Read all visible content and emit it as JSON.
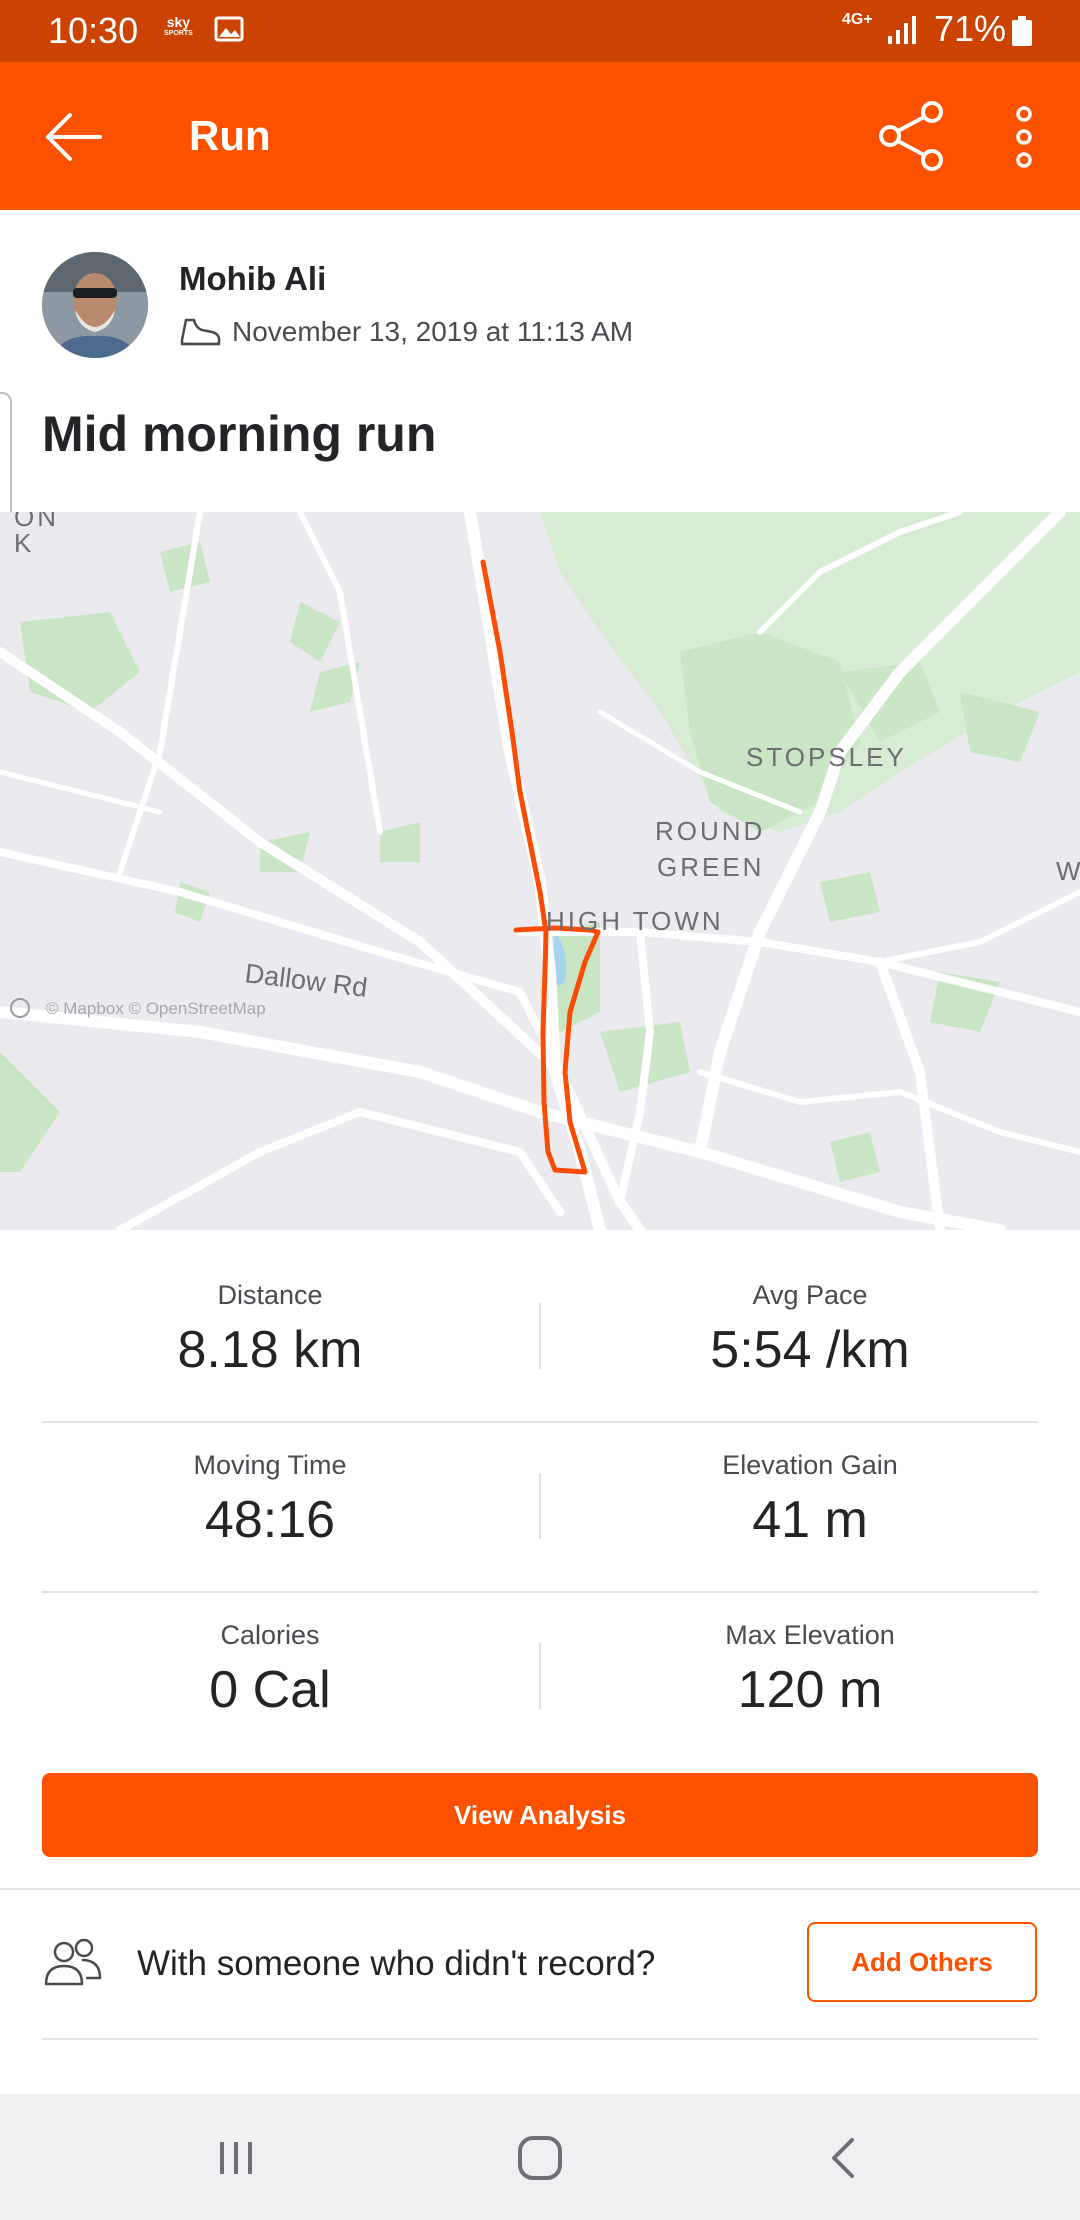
{
  "status_bar": {
    "time": "10:30",
    "sky_sports_line1": "sky",
    "sky_sports_line2": "SPORTS",
    "network": "4G+",
    "battery": "71%"
  },
  "app_bar": {
    "title": "Run",
    "back_icon": "arrow-left",
    "share_icon": "share",
    "more_icon": "more-vertical"
  },
  "activity": {
    "athlete_name": "Mohib Ali",
    "datetime": "November 13, 2019 at 11:13 AM",
    "title": "Mid morning run"
  },
  "map": {
    "labels": {
      "stopsley": "STOPSLEY",
      "round": "ROUND",
      "green": "GREEN",
      "high_town": "HIGH TOWN",
      "dallow_rd": "Dallow Rd",
      "edge_top_1": "ON",
      "edge_top_2": "K",
      "edge_right": "W"
    },
    "attribution": "© Mapbox © OpenStreetMap",
    "route_color": "#fc4c02"
  },
  "stats": {
    "distance_label": "Distance",
    "distance_value": "8.18 km",
    "avg_pace_label": "Avg Pace",
    "avg_pace_value": "5:54 /km",
    "moving_time_label": "Moving Time",
    "moving_time_value": "48:16",
    "elevation_gain_label": "Elevation Gain",
    "elevation_gain_value": "41 m",
    "calories_label": "Calories",
    "calories_value": "0 Cal",
    "max_elevation_label": "Max Elevation",
    "max_elevation_value": "120 m"
  },
  "actions": {
    "view_analysis": "View Analysis",
    "with_someone": "With someone who didn't record?",
    "add_others": "Add Others"
  },
  "colors": {
    "brand": "#fc5200",
    "status_bar": "#cc4200"
  }
}
